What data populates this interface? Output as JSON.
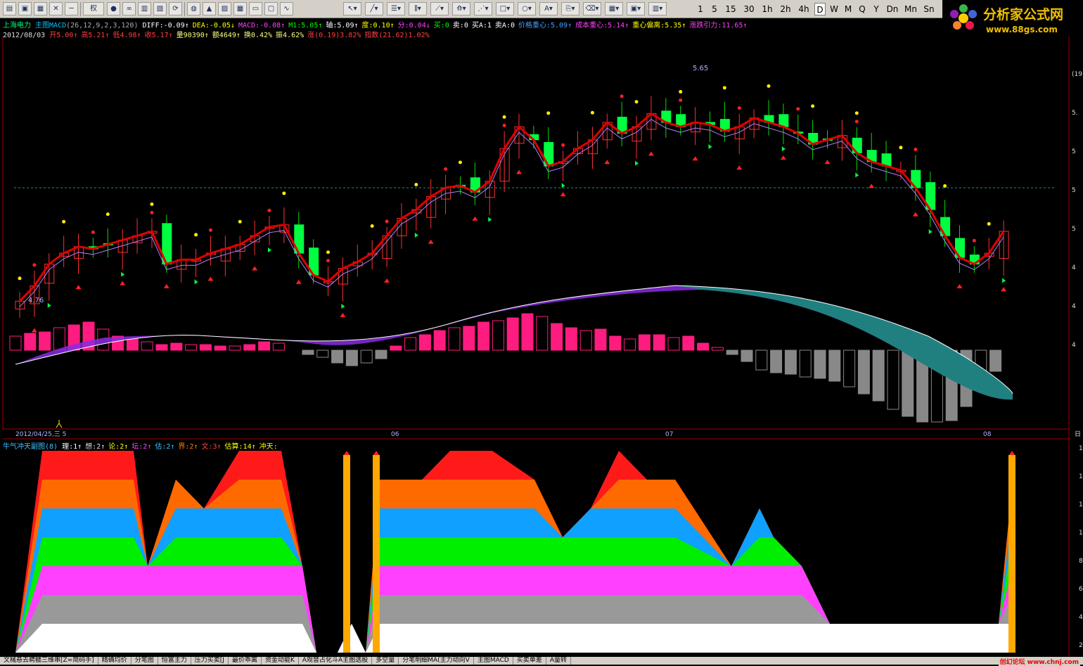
{
  "toolbar": {
    "icons": [
      "open-folder-icon",
      "save-icon",
      "data-icon",
      "close-icon",
      "minimize-icon",
      "rights-icon",
      "record-icon",
      "glasses-icon",
      "f10-icon",
      "book-icon",
      "refresh-icon",
      "globe-icon",
      "alarm-icon",
      "chart-icon",
      "table-icon",
      "page-icon",
      "window-icon",
      "line-icon"
    ],
    "rights_label": "权",
    "periods": [
      {
        "label": "1",
        "selected": false
      },
      {
        "label": "5",
        "selected": false
      },
      {
        "label": "15",
        "selected": false
      },
      {
        "label": "30",
        "selected": false
      },
      {
        "label": "1h",
        "selected": false
      },
      {
        "label": "2h",
        "selected": false
      },
      {
        "label": "4h",
        "selected": false
      },
      {
        "label": "D",
        "selected": true
      },
      {
        "label": "W",
        "selected": false
      },
      {
        "label": "M",
        "selected": false
      },
      {
        "label": "Q",
        "selected": false
      },
      {
        "label": "Y",
        "selected": false
      },
      {
        "label": "Dn",
        "selected": false
      },
      {
        "label": "Mn",
        "selected": false
      },
      {
        "label": "Sn",
        "selected": false
      }
    ]
  },
  "logo": {
    "title": "分析家公式网",
    "url": "www.88gs.com"
  },
  "header": {
    "stock_name": "上海电力",
    "indicator_name": "主图MACD",
    "indicator_params": "(26,12,9,2,3,120)",
    "indicators": [
      {
        "label": "DIFF:-0.09↑",
        "color": "#ffffff"
      },
      {
        "label": "DEA:-0.05↓",
        "color": "#ffff00"
      },
      {
        "label": "MACD:-0.08↑",
        "color": "#ff40ff"
      },
      {
        "label": "M1:5.05↑",
        "color": "#00ff00"
      },
      {
        "label": "轴:5.09↑",
        "color": "#ffffff"
      },
      {
        "label": "度:0.10↑",
        "color": "#ffff00"
      },
      {
        "label": "分:0.04↓",
        "color": "#ff40ff"
      },
      {
        "label": "买:0",
        "color": "#00ff00"
      },
      {
        "label": "卖:0",
        "color": "#ffffff"
      },
      {
        "label": "买A:1",
        "color": "#ffffff"
      },
      {
        "label": "卖A:0",
        "color": "#ffffff"
      },
      {
        "label": "价格重心:5.09↑",
        "color": "#40a0ff"
      },
      {
        "label": "成本重心:5.14↑",
        "color": "#ff40ff"
      },
      {
        "label": "重心偏离:5.35↑",
        "color": "#ffff00"
      },
      {
        "label": "涨跌引力:11.65↑",
        "color": "#ff40ff"
      }
    ],
    "date": "2012/08/03",
    "quote": [
      {
        "label": "开5.00↑",
        "color": "#ff4040"
      },
      {
        "label": "高5.21↑",
        "color": "#ff4040"
      },
      {
        "label": "低4.98↑",
        "color": "#ff4040"
      },
      {
        "label": "收5.17↑",
        "color": "#ff4040"
      },
      {
        "label": "量90390↑",
        "color": "#ffff80"
      },
      {
        "label": "额4649↑",
        "color": "#ffff80"
      },
      {
        "label": "换0.42%",
        "color": "#ffff80"
      },
      {
        "label": "振4.62%",
        "color": "#ffff80"
      },
      {
        "label": "涨(0.19)3.82%",
        "color": "#ff4040"
      },
      {
        "label": "指数(21.62)1.02%",
        "color": "#ff4040"
      }
    ]
  },
  "chart": {
    "high_label": "5.65",
    "low_label": "4.76",
    "right_axis": [
      "(19",
      "5.",
      "5",
      "5",
      "5",
      "4",
      "4",
      "4"
    ],
    "date_labels": [
      "2012/04/25,三 5",
      "06",
      "07",
      "08"
    ],
    "end_label": "日"
  },
  "sub": {
    "title": "牛气冲天副图(8)",
    "items": [
      {
        "label": "理:1↑",
        "color": "#ffffff"
      },
      {
        "label": "想:2↑",
        "color": "#dddddd"
      },
      {
        "label": "论:2↑",
        "color": "#ffff00"
      },
      {
        "label": "坛:2↑",
        "color": "#ff40ff"
      },
      {
        "label": "估:2↑",
        "color": "#40c0ff"
      },
      {
        "label": "界:2↑",
        "color": "#ff8000"
      },
      {
        "label": "文:3↑",
        "color": "#ff4040"
      },
      {
        "label": "估算:14↑",
        "color": "#ffff00"
      },
      {
        "label": "冲天:",
        "color": "#ffff00"
      }
    ],
    "right_axis": [
      "1",
      "1",
      "1",
      "1",
      "8",
      "6",
      "4",
      "2"
    ]
  },
  "status_bar": [
    "文械悬去聘髅三维串[Z=简码手]",
    "精确均价",
    "分笔图",
    "恒富主力",
    "压力买卖[J",
    "最价乖离",
    "资金动能K",
    "A观音占化斗A主图选股",
    "多空量",
    "分笔明细MA(主力动向V",
    "主图MACD",
    "买卖单差",
    "A量转"
  ],
  "footer_watermark": "创幻论坛 www.chnj.com"
}
